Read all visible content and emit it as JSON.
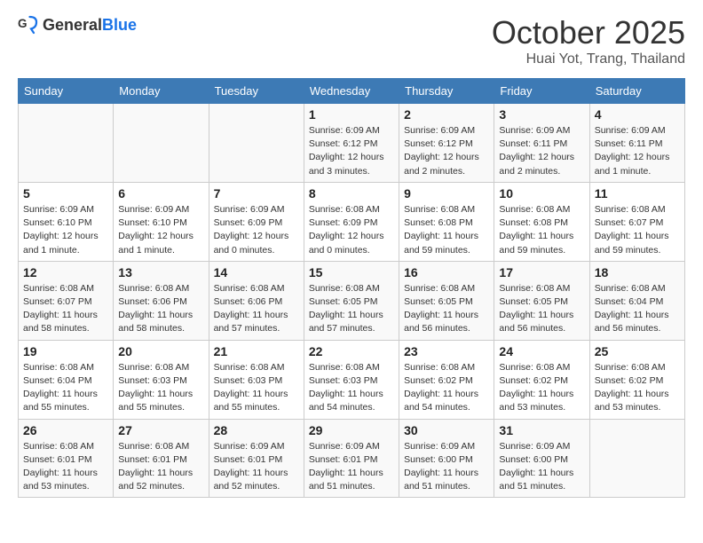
{
  "header": {
    "logo_general": "General",
    "logo_blue": "Blue",
    "title": "October 2025",
    "subtitle": "Huai Yot, Trang, Thailand"
  },
  "weekdays": [
    "Sunday",
    "Monday",
    "Tuesday",
    "Wednesday",
    "Thursday",
    "Friday",
    "Saturday"
  ],
  "weeks": [
    [
      {
        "day": "",
        "info": ""
      },
      {
        "day": "",
        "info": ""
      },
      {
        "day": "",
        "info": ""
      },
      {
        "day": "1",
        "info": "Sunrise: 6:09 AM\nSunset: 6:12 PM\nDaylight: 12 hours and 3 minutes."
      },
      {
        "day": "2",
        "info": "Sunrise: 6:09 AM\nSunset: 6:12 PM\nDaylight: 12 hours and 2 minutes."
      },
      {
        "day": "3",
        "info": "Sunrise: 6:09 AM\nSunset: 6:11 PM\nDaylight: 12 hours and 2 minutes."
      },
      {
        "day": "4",
        "info": "Sunrise: 6:09 AM\nSunset: 6:11 PM\nDaylight: 12 hours and 1 minute."
      }
    ],
    [
      {
        "day": "5",
        "info": "Sunrise: 6:09 AM\nSunset: 6:10 PM\nDaylight: 12 hours and 1 minute."
      },
      {
        "day": "6",
        "info": "Sunrise: 6:09 AM\nSunset: 6:10 PM\nDaylight: 12 hours and 1 minute."
      },
      {
        "day": "7",
        "info": "Sunrise: 6:09 AM\nSunset: 6:09 PM\nDaylight: 12 hours and 0 minutes."
      },
      {
        "day": "8",
        "info": "Sunrise: 6:08 AM\nSunset: 6:09 PM\nDaylight: 12 hours and 0 minutes."
      },
      {
        "day": "9",
        "info": "Sunrise: 6:08 AM\nSunset: 6:08 PM\nDaylight: 11 hours and 59 minutes."
      },
      {
        "day": "10",
        "info": "Sunrise: 6:08 AM\nSunset: 6:08 PM\nDaylight: 11 hours and 59 minutes."
      },
      {
        "day": "11",
        "info": "Sunrise: 6:08 AM\nSunset: 6:07 PM\nDaylight: 11 hours and 59 minutes."
      }
    ],
    [
      {
        "day": "12",
        "info": "Sunrise: 6:08 AM\nSunset: 6:07 PM\nDaylight: 11 hours and 58 minutes."
      },
      {
        "day": "13",
        "info": "Sunrise: 6:08 AM\nSunset: 6:06 PM\nDaylight: 11 hours and 58 minutes."
      },
      {
        "day": "14",
        "info": "Sunrise: 6:08 AM\nSunset: 6:06 PM\nDaylight: 11 hours and 57 minutes."
      },
      {
        "day": "15",
        "info": "Sunrise: 6:08 AM\nSunset: 6:05 PM\nDaylight: 11 hours and 57 minutes."
      },
      {
        "day": "16",
        "info": "Sunrise: 6:08 AM\nSunset: 6:05 PM\nDaylight: 11 hours and 56 minutes."
      },
      {
        "day": "17",
        "info": "Sunrise: 6:08 AM\nSunset: 6:05 PM\nDaylight: 11 hours and 56 minutes."
      },
      {
        "day": "18",
        "info": "Sunrise: 6:08 AM\nSunset: 6:04 PM\nDaylight: 11 hours and 56 minutes."
      }
    ],
    [
      {
        "day": "19",
        "info": "Sunrise: 6:08 AM\nSunset: 6:04 PM\nDaylight: 11 hours and 55 minutes."
      },
      {
        "day": "20",
        "info": "Sunrise: 6:08 AM\nSunset: 6:03 PM\nDaylight: 11 hours and 55 minutes."
      },
      {
        "day": "21",
        "info": "Sunrise: 6:08 AM\nSunset: 6:03 PM\nDaylight: 11 hours and 55 minutes."
      },
      {
        "day": "22",
        "info": "Sunrise: 6:08 AM\nSunset: 6:03 PM\nDaylight: 11 hours and 54 minutes."
      },
      {
        "day": "23",
        "info": "Sunrise: 6:08 AM\nSunset: 6:02 PM\nDaylight: 11 hours and 54 minutes."
      },
      {
        "day": "24",
        "info": "Sunrise: 6:08 AM\nSunset: 6:02 PM\nDaylight: 11 hours and 53 minutes."
      },
      {
        "day": "25",
        "info": "Sunrise: 6:08 AM\nSunset: 6:02 PM\nDaylight: 11 hours and 53 minutes."
      }
    ],
    [
      {
        "day": "26",
        "info": "Sunrise: 6:08 AM\nSunset: 6:01 PM\nDaylight: 11 hours and 53 minutes."
      },
      {
        "day": "27",
        "info": "Sunrise: 6:08 AM\nSunset: 6:01 PM\nDaylight: 11 hours and 52 minutes."
      },
      {
        "day": "28",
        "info": "Sunrise: 6:09 AM\nSunset: 6:01 PM\nDaylight: 11 hours and 52 minutes."
      },
      {
        "day": "29",
        "info": "Sunrise: 6:09 AM\nSunset: 6:01 PM\nDaylight: 11 hours and 51 minutes."
      },
      {
        "day": "30",
        "info": "Sunrise: 6:09 AM\nSunset: 6:00 PM\nDaylight: 11 hours and 51 minutes."
      },
      {
        "day": "31",
        "info": "Sunrise: 6:09 AM\nSunset: 6:00 PM\nDaylight: 11 hours and 51 minutes."
      },
      {
        "day": "",
        "info": ""
      }
    ]
  ]
}
